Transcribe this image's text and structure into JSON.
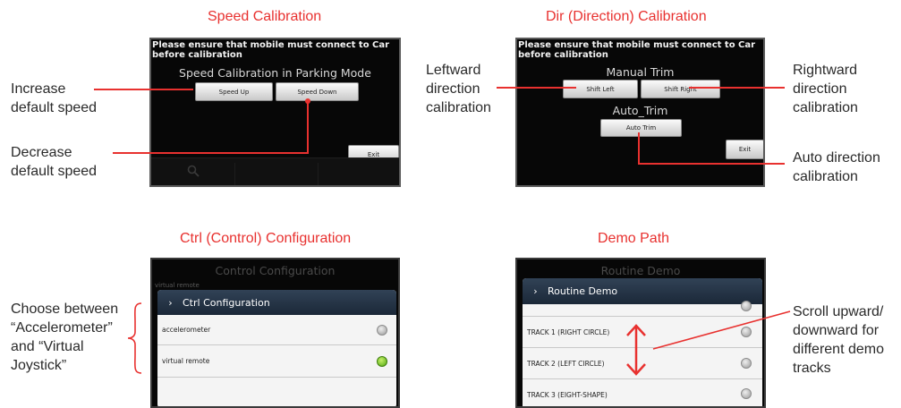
{
  "panels": {
    "speed": {
      "title": "Speed Calibration",
      "warning": "Please ensure that mobile must connect to Car before calibration",
      "subtitle": "Speed Calibration in Parking Mode",
      "buttons": {
        "speed_up": "Speed Up",
        "speed_down": "Speed Down",
        "exit": "Exit"
      },
      "annotations": {
        "increase": [
          "Increase",
          "default speed"
        ],
        "decrease": [
          "Decrease",
          "default speed"
        ]
      }
    },
    "direction": {
      "title": "Dir (Direction) Calibration",
      "warning": "Please ensure that mobile must connect to Car before calibration",
      "manual_trim": "Manual Trim",
      "auto_trim": "Auto_Trim",
      "buttons": {
        "shift_left": "Shift Left",
        "shift_right": "Shift Right",
        "auto_trim": "Auto Trim",
        "exit": "Exit"
      },
      "annotations": {
        "leftward": [
          "Leftward",
          "direction",
          "calibration"
        ],
        "rightward": [
          "Rightward",
          "direction",
          "calibration"
        ],
        "auto": [
          "Auto direction",
          "calibration"
        ]
      }
    },
    "control": {
      "title": "Ctrl (Control) Configuration",
      "background_title": "Control Configuration",
      "background_row": "virtual remote",
      "dialog_title": "Ctrl Configuration",
      "options": [
        {
          "label": "accelerometer",
          "selected": false
        },
        {
          "label": "virtual remote",
          "selected": true
        }
      ],
      "annotation": [
        "Choose between",
        "“Accelerometer”",
        "and “Virtual",
        "Joystick”"
      ]
    },
    "demo": {
      "title": "Demo Path",
      "background_title": "Routine Demo",
      "dialog_title": "Routine Demo",
      "tracks": [
        "TRACK 1 (RIGHT CIRCLE)",
        "TRACK 2 (LEFT CIRCLE)",
        "TRACK 3 (EIGHT-SHAPE)"
      ],
      "annotation": [
        "Scroll upward/",
        "downward for",
        "different demo",
        "tracks"
      ]
    }
  },
  "colors": {
    "accent": "#e8312f",
    "screen_bg": "#070707",
    "dialog_header": "#1f2c3d",
    "radio_on": "#5fb81a"
  }
}
